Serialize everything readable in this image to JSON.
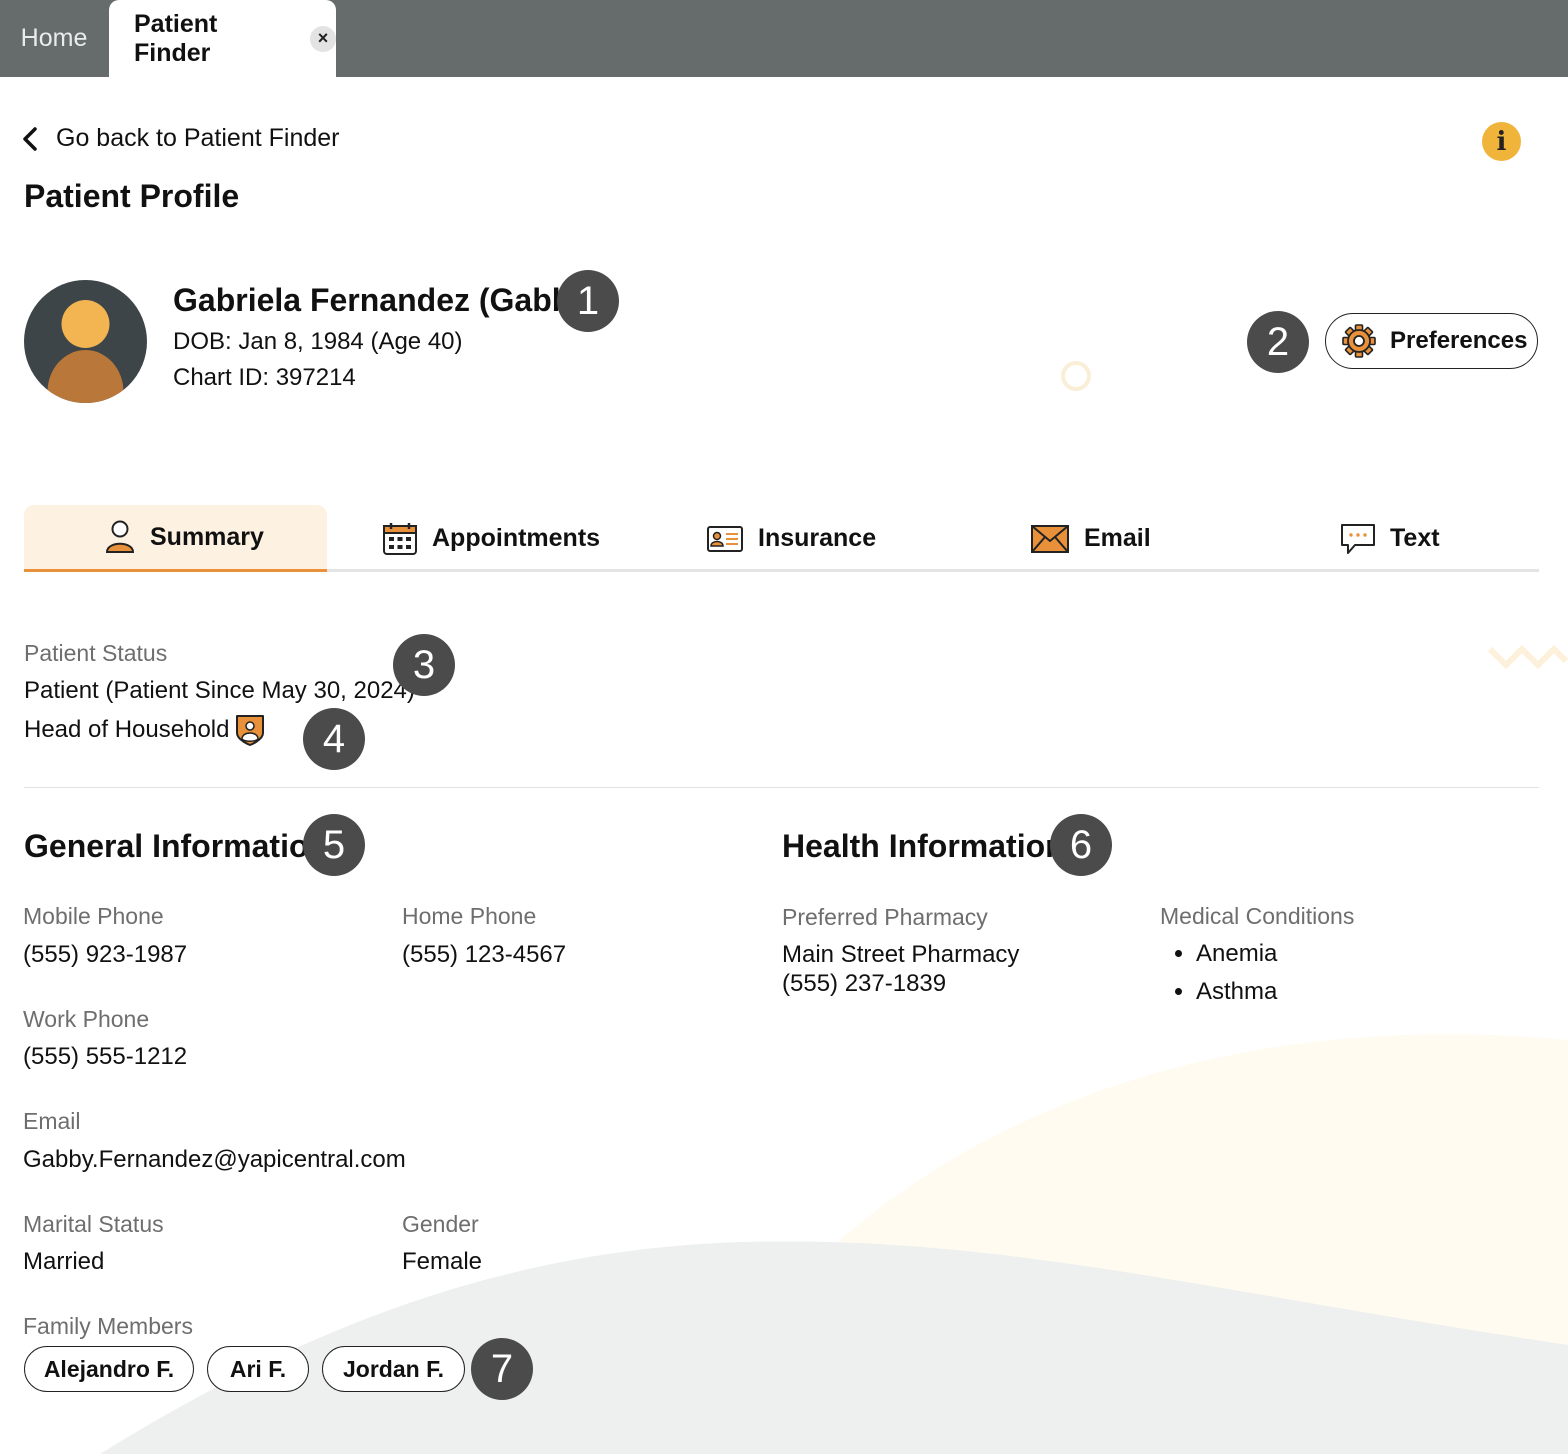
{
  "window_tabs": {
    "home_label": "Home",
    "active_label": "Patient Finder",
    "close_symbol": "×"
  },
  "nav": {
    "back_label": "Go back to Patient Finder",
    "info_symbol": "i"
  },
  "page": {
    "title": "Patient Profile"
  },
  "patient": {
    "name": "Gabriela Fernandez (Gabby)",
    "dob": "DOB: Jan 8, 1984 (Age 40)",
    "chart_id": "Chart ID: 397214"
  },
  "preferences_label": "Preferences",
  "profile_tabs": [
    {
      "label": "Summary",
      "icon": "person-icon"
    },
    {
      "label": "Appointments",
      "icon": "calendar-icon"
    },
    {
      "label": "Insurance",
      "icon": "id-card-icon"
    },
    {
      "label": "Email",
      "icon": "envelope-icon"
    },
    {
      "label": "Text",
      "icon": "chat-bubble-icon"
    }
  ],
  "status": {
    "label": "Patient Status",
    "value": "Patient (Patient Since May 30, 2024)",
    "household": "Head of Household"
  },
  "general": {
    "title": "General Information",
    "mobile_label": "Mobile Phone",
    "mobile_value": "(555) 923-1987",
    "home_label": "Home Phone",
    "home_value": "(555) 123-4567",
    "work_label": "Work Phone",
    "work_value": "(555) 555-1212",
    "email_label": "Email",
    "email_value": "Gabby.Fernandez@yapicentral.com",
    "marital_label": "Marital Status",
    "marital_value": "Married",
    "gender_label": "Gender",
    "gender_value": "Female",
    "family_label": "Family Members",
    "family_members": [
      "Alejandro F.",
      "Ari F.",
      "Jordan F."
    ]
  },
  "health": {
    "title": "Health Information",
    "pharmacy_label": "Preferred Pharmacy",
    "pharmacy_name": "Main Street Pharmacy",
    "pharmacy_phone": "(555) 237-1839",
    "conditions_label": "Medical Conditions",
    "conditions": [
      "Anemia",
      "Asthma"
    ]
  },
  "callouts": [
    "1",
    "2",
    "3",
    "4",
    "5",
    "6",
    "7"
  ],
  "colors": {
    "accent": "#e8913a",
    "tabbar": "#666b6b",
    "badge": "#4b4b4b",
    "info": "#f0b43a"
  }
}
